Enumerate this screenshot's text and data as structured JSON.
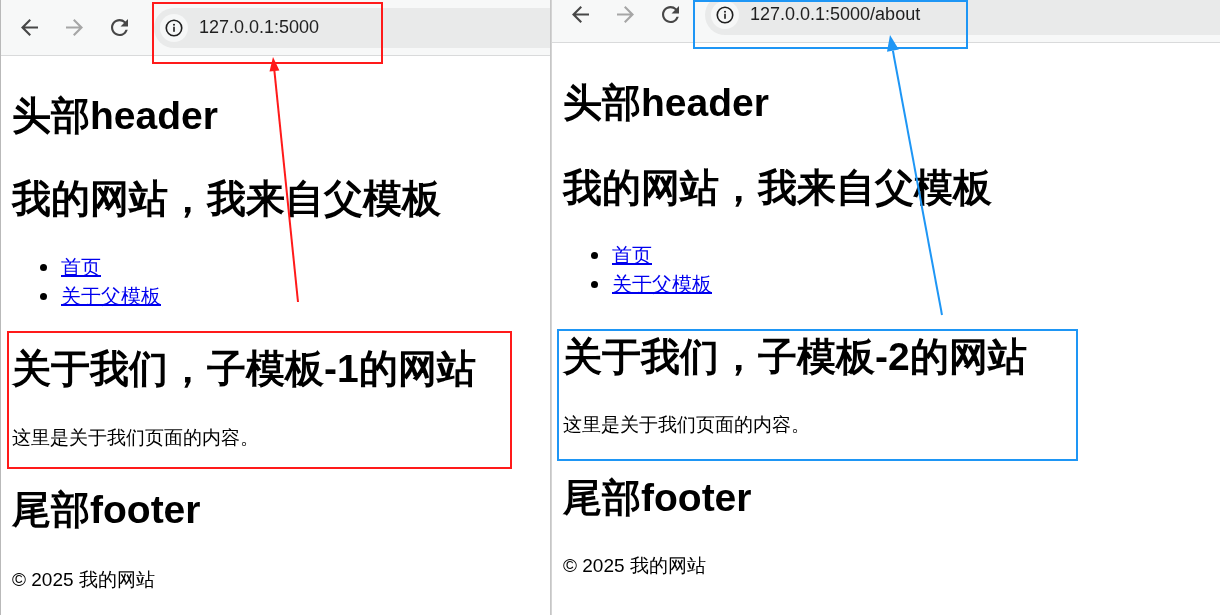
{
  "windows": [
    {
      "color": "#ff1a1a",
      "nav_buttons": [
        {
          "kind": "back",
          "disabled": false
        },
        {
          "kind": "forward",
          "disabled": true
        },
        {
          "kind": "reload",
          "disabled": false
        }
      ],
      "address": "127.0.0.1:5000",
      "page": {
        "header": "头部header",
        "site_title": "我的网站，我来自父模板",
        "nav_links": [
          "首页",
          "关于父模板"
        ],
        "section": {
          "title": "关于我们，子模板-1的网站",
          "text": "这里是关于我们页面的内容。"
        },
        "footer": "尾部footer",
        "copyright": "© 2025 我的网站"
      }
    },
    {
      "color": "#1e96f5",
      "nav_buttons": [
        {
          "kind": "back",
          "disabled": false
        },
        {
          "kind": "forward",
          "disabled": true
        },
        {
          "kind": "reload",
          "disabled": false
        }
      ],
      "address": "127.0.0.1:5000/about",
      "page": {
        "header": "头部header",
        "site_title": "我的网站，我来自父模板",
        "nav_links": [
          "首页",
          "关于父模板"
        ],
        "section": {
          "title": "关于我们，子模板-2的网站",
          "text": "这里是关于我们页面的内容。"
        },
        "footer": "尾部footer",
        "copyright": "© 2025 我的网站"
      }
    }
  ]
}
